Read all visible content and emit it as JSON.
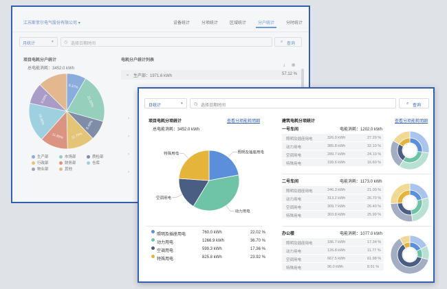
{
  "back": {
    "company": "江苏斯菲尔电气股份有限公司",
    "tabs": [
      "设备统计",
      "分项统计",
      "区域统计",
      "分户统计",
      "分时统计"
    ],
    "active_tab": 3,
    "period": "月统计",
    "date_placeholder": "选择日期时间",
    "search_label": "查询",
    "left_title": "项目电耗分户统计",
    "total_label": "总电能消耗：",
    "total_value": "3452.0 kWh",
    "right_title": "电耗分户统计列表",
    "first_row_name": "生产部：1971.6 kWh",
    "first_row_pct": "57.12 %",
    "legend": [
      {
        "label": "生产部",
        "color": "#5b8fd9"
      },
      {
        "label": "市场部",
        "color": "#6fc3a7"
      },
      {
        "label": "质检部",
        "color": "#4a5e84"
      },
      {
        "label": "行政部",
        "color": "#e5b43b"
      },
      {
        "label": "财务部",
        "color": "#d9694c"
      },
      {
        "label": "仓库",
        "color": "#7cc5dc"
      },
      {
        "label": "物业部",
        "color": "#8b75b5"
      },
      {
        "label": "其他",
        "color": "#e4a060"
      }
    ],
    "chart_data": {
      "type": "pie",
      "categories": [
        "生产部",
        "市场部",
        "质检部",
        "行政部",
        "财务部",
        "仓库",
        "物业部",
        "其他"
      ],
      "values": [
        8.37,
        21.0,
        8.49,
        11.79,
        11.89,
        16.9,
        9.0,
        12.56
      ],
      "data_labels": [
        "8.37%",
        "21.00%",
        "8.49%",
        "11.79%",
        "11.89%",
        "16.90%",
        "9.00%",
        ""
      ]
    }
  },
  "front": {
    "period": "日统计",
    "date_placeholder": "选择日期时间",
    "search_label": "查询",
    "left_title": "项目电耗分项统计",
    "left_link": "查看分项能耗明细",
    "total_label": "总电能消耗：",
    "total_value": "3452.0 kWh",
    "pie_labels": [
      "照明及插座用电",
      "动力用电",
      "空调用电",
      "特殊用电"
    ],
    "chart_data": {
      "type": "pie",
      "categories": [
        "照明及插座用电",
        "动力用电",
        "空调用电",
        "特殊用电"
      ],
      "values": [
        22.02,
        36.7,
        17.36,
        23.92
      ]
    },
    "items": [
      {
        "name": "照明及插座用电",
        "value": "760.0 kWh",
        "pct": "22.02 %",
        "color": "#5b8fd9"
      },
      {
        "name": "动力用电",
        "value": "1266.9 kWh",
        "pct": "36.70 %",
        "color": "#6fc3a7"
      },
      {
        "name": "空调用电",
        "value": "599.3 kWh",
        "pct": "17.36 %",
        "color": "#4a5e84"
      },
      {
        "name": "特殊用电",
        "value": "825.8 kWh",
        "pct": "23.92 %",
        "color": "#e5b43b"
      }
    ],
    "right_title": "建筑电耗分项统计",
    "right_link": "查看分项能耗明细",
    "energy_label": "电能消耗：",
    "buildings": [
      {
        "name": "一号车间",
        "total": "1202.0 kWh",
        "rows": [
          {
            "name": "照明及插座用电",
            "value": "326.9 kWh",
            "pct": "27.20 %"
          },
          {
            "name": "动力用电",
            "value": "385.8 kWh",
            "pct": "32.10 %"
          },
          {
            "name": "空调用电",
            "value": "289.7 kWh",
            "pct": "24.10 %"
          },
          {
            "name": "特殊用电",
            "value": "199.6 kWh",
            "pct": "16.60 %"
          }
        ],
        "chart_data": {
          "type": "pie",
          "categories": [
            "照明及插座用电",
            "动力用电",
            "空调用电",
            "特殊用电"
          ],
          "values": [
            27.2,
            32.1,
            24.1,
            16.6
          ]
        }
      },
      {
        "name": "二号车间",
        "total": "1173.0 kWh",
        "rows": [
          {
            "name": "照明及插座用电",
            "value": "246.3 kWh",
            "pct": "21.00 %"
          },
          {
            "name": "动力用电",
            "value": "313.2 kWh",
            "pct": "26.70 %"
          },
          {
            "name": "空调用电",
            "value": "309.7 kWh",
            "pct": "26.40 %"
          },
          {
            "name": "特殊用电",
            "value": "303.8 kWh",
            "pct": "25.90 %"
          }
        ],
        "chart_data": {
          "type": "pie",
          "categories": [
            "照明及插座用电",
            "动力用电",
            "空调用电",
            "特殊用电"
          ],
          "values": [
            21.0,
            26.7,
            26.4,
            25.9
          ]
        }
      },
      {
        "name": "办公楼",
        "total": "1077.0 kWh",
        "rows": [
          {
            "name": "照明及插座用电",
            "value": "186.7 kWh",
            "pct": "17.34 %"
          },
          {
            "name": "动力用电",
            "value": "126.8 kWh",
            "pct": "11.77 %"
          },
          {
            "name": "空调用电",
            "value": "667.5 kWh",
            "pct": "61.98 %"
          },
          {
            "name": "特殊用电",
            "value": "96.0 kWh",
            "pct": "8.91 %"
          }
        ],
        "chart_data": {
          "type": "pie",
          "categories": [
            "照明及插座用电",
            "动力用电",
            "空调用电",
            "特殊用电"
          ],
          "values": [
            17.34,
            11.77,
            61.98,
            8.91
          ]
        }
      }
    ]
  }
}
